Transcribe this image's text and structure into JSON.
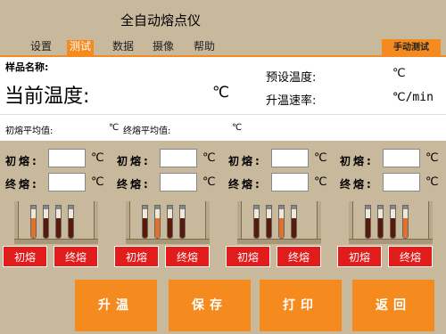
{
  "app": {
    "title": "全自动熔点仪"
  },
  "menu": {
    "items": [
      "设置",
      "测试",
      "数据",
      "摄像",
      "帮助"
    ],
    "active_index": 1
  },
  "manual_test": "手动测试",
  "info": {
    "sample_label": "样品名称:",
    "current_temp_label": "当前温度:",
    "current_temp_unit": "℃",
    "preset_temp_label": "预设温度:",
    "preset_temp_unit": "℃",
    "rate_label": "升温速率:",
    "rate_unit": "℃/min"
  },
  "averages": {
    "initial_label": "初熔平均值:",
    "initial_unit": "℃",
    "final_label": "终熔平均值:",
    "final_unit": "℃"
  },
  "groups": [
    {
      "initial_label": "初熔:",
      "final_label": "终熔:",
      "unit": "℃",
      "btn_initial": "初熔",
      "btn_final": "终熔"
    },
    {
      "initial_label": "初熔:",
      "final_label": "终熔:",
      "unit": "℃",
      "btn_initial": "初熔",
      "btn_final": "终熔"
    },
    {
      "initial_label": "初熔:",
      "final_label": "终熔:",
      "unit": "℃",
      "btn_initial": "初熔",
      "btn_final": "终熔"
    },
    {
      "initial_label": "初熔:",
      "final_label": "终熔:",
      "unit": "℃",
      "btn_initial": "初熔",
      "btn_final": "终熔"
    }
  ],
  "actions": {
    "heat": "升温",
    "save": "保存",
    "print": "打印",
    "back": "返回"
  },
  "colors": {
    "background": "#c8b89c",
    "accent": "#f58a1e",
    "red_button": "#e21b1b"
  }
}
